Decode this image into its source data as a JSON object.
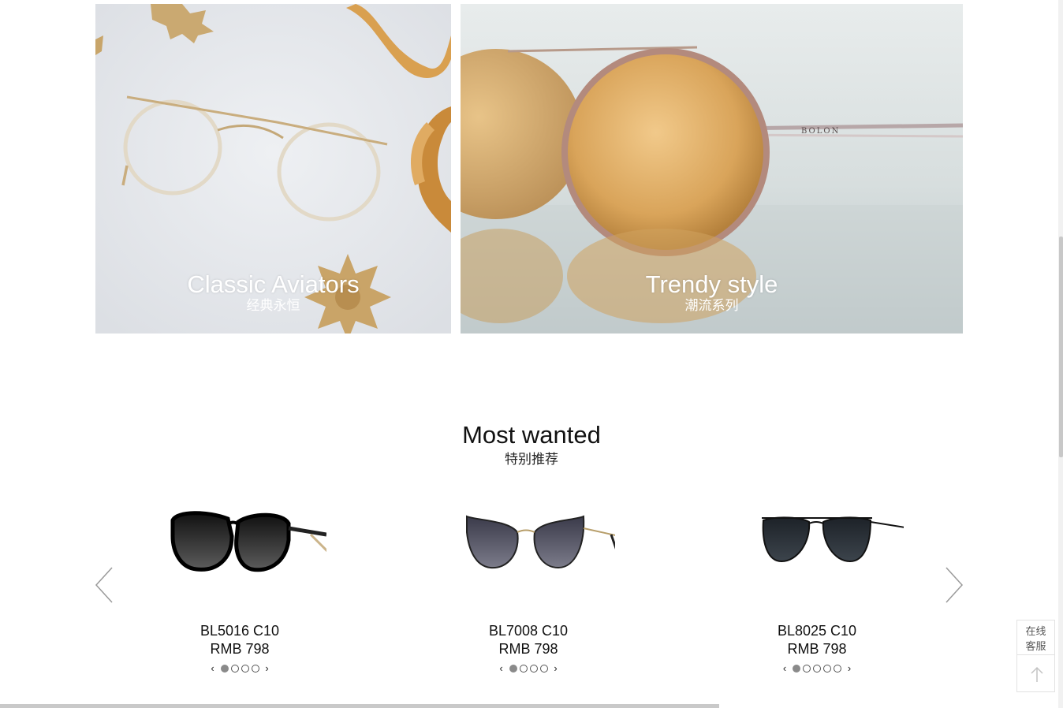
{
  "banners": [
    {
      "title": "Classic Aviators",
      "subtitle": "经典永恒"
    },
    {
      "title": "Trendy style",
      "subtitle": "潮流系列",
      "brand_mark": "BOLON"
    }
  ],
  "section": {
    "title": "Most wanted",
    "subtitle": "特别推荐"
  },
  "carousel": {
    "prev_icon": "chevron-left-icon",
    "next_icon": "chevron-right-icon",
    "products": [
      {
        "model": "BL5016 C10",
        "price": "RMB 798",
        "color_count": 4,
        "active_color": 1
      },
      {
        "model": "BL7008 C10",
        "price": "RMB 798",
        "color_count": 4,
        "active_color": 1
      },
      {
        "model": "BL8025 C10",
        "price": "RMB 798",
        "color_count": 5,
        "active_color": 1
      }
    ]
  },
  "swatch_prev": "‹",
  "swatch_next": "›",
  "side": {
    "service_line1": "在线",
    "service_line2": "客服",
    "top_icon": "arrow-up-icon"
  }
}
